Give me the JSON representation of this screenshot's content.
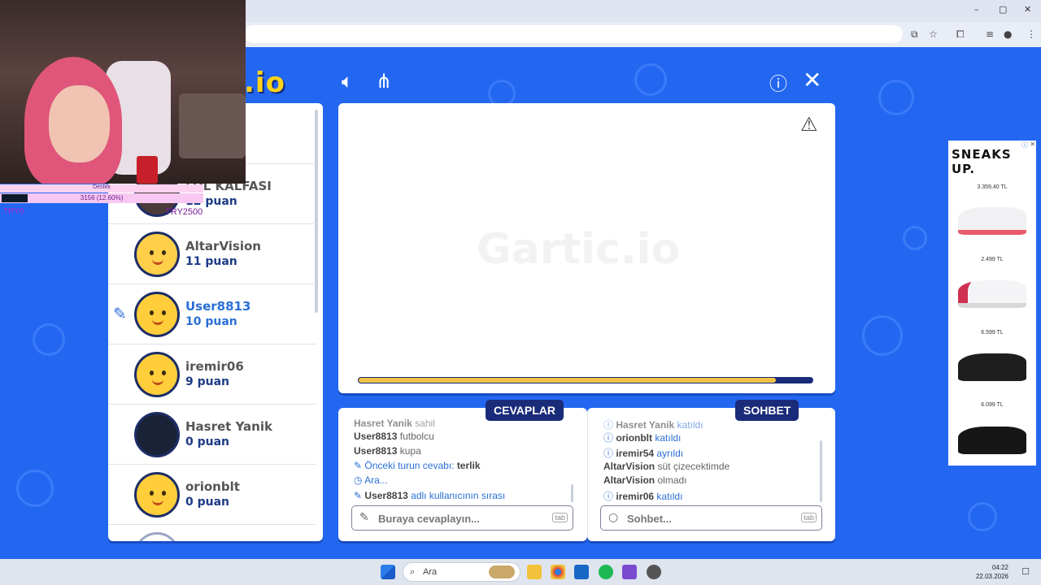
{
  "browser": {
    "window_controls": {
      "minimize": "–",
      "maximize": "▢",
      "close": "✕"
    }
  },
  "game": {
    "logo": ".io",
    "players": [
      {
        "name": "LOL KALFASI",
        "score": "12 puan"
      },
      {
        "name": "AltarVision",
        "score": "11 puan"
      },
      {
        "name": "User8813",
        "score": "10 puan"
      },
      {
        "name": "iremir06",
        "score": "9 puan"
      },
      {
        "name": "Hasret Yanik",
        "score": "0 puan"
      },
      {
        "name": "orionblt",
        "score": "0 puan"
      }
    ],
    "canvas_watermark": "Gartic.io",
    "timer_fraction": 0.92,
    "answers_tab": "CEVAPLAR",
    "chat_tab": "SOHBET",
    "answers_log": [
      {
        "user": "Hasret Yanik",
        "text": "sahil"
      },
      {
        "user": "User8813",
        "text": "futbolcu"
      },
      {
        "user": "User8813",
        "text": "kupa"
      },
      {
        "prefix": "Önceki turun cevabı:",
        "value": "terlik"
      },
      {
        "text": "Ara..."
      },
      {
        "user": "User8813",
        "text": "adlı kullanıcının sırası"
      }
    ],
    "chat_log": [
      {
        "user": "Hasret Yanik",
        "text": "katıldı"
      },
      {
        "user": "orionblt",
        "text": "katıldı"
      },
      {
        "user": "iremir54",
        "text": "ayrıldı"
      },
      {
        "user": "AltarVision",
        "text": "süt çizecektimde"
      },
      {
        "user": "AltarVision",
        "text": "olmadı"
      },
      {
        "user": "iremir06",
        "text": "katıldı"
      }
    ],
    "answer_placeholder": "Buraya cevaplayın...",
    "chat_placeholder": "Sohbet...",
    "tab_hint": "tab"
  },
  "ad": {
    "brand": "SNEAKS UP.",
    "prices": [
      "3.359,40 TL",
      "2.499 TL",
      "6.599 TL",
      "6.099 TL"
    ]
  },
  "stream_overlay": {
    "goal_label": "Destek",
    "progress_text": "3156 (12.60%)",
    "progress_fraction": 0.126,
    "left_amount": "TRY0",
    "right_amount": "TRY2500"
  },
  "taskbar": {
    "search_label": "Ara",
    "time": "04:22",
    "date": "22.03.2026"
  }
}
